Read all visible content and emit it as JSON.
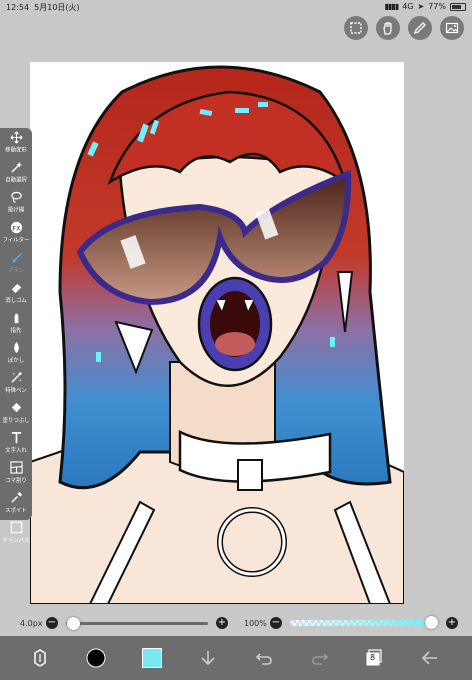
{
  "status": {
    "time": "12:54",
    "date": "5月10日(火)",
    "signal": "4G",
    "battery": "77%",
    "battery_level": 0.77
  },
  "toolbar": {
    "items": [
      {
        "label": "移動変形",
        "icon": "move-icon"
      },
      {
        "label": "自動選択",
        "icon": "magic-wand-icon"
      },
      {
        "label": "投げ縄",
        "icon": "lasso-icon"
      },
      {
        "label": "フィルター",
        "icon": "fx-icon"
      },
      {
        "label": "ブラシ",
        "icon": "brush-icon"
      },
      {
        "label": "消しゴム",
        "icon": "eraser-icon"
      },
      {
        "label": "指先",
        "icon": "finger-smudge-icon"
      },
      {
        "label": "ぼかし",
        "icon": "blur-drop-icon"
      },
      {
        "label": "特殊ペン",
        "icon": "special-pen-icon"
      },
      {
        "label": "塗りつぶし",
        "icon": "fill-bucket-icon"
      },
      {
        "label": "文字入れ",
        "icon": "text-icon"
      },
      {
        "label": "コマ割り",
        "icon": "frame-divide-icon"
      },
      {
        "label": "スポイト",
        "icon": "eyedropper-icon"
      },
      {
        "label": "キャンバス",
        "icon": "canvas-icon"
      }
    ],
    "selected": "ブラシ"
  },
  "brush": {
    "size_label": "4.0px",
    "size_level": 0.05,
    "opacity_label": "100%",
    "opacity_level": 1.0
  },
  "colors": {
    "accent": "#2d7ff0",
    "current_color": "#7be8f1",
    "bar": "#6d6d6d"
  },
  "layers": {
    "count": "8"
  }
}
